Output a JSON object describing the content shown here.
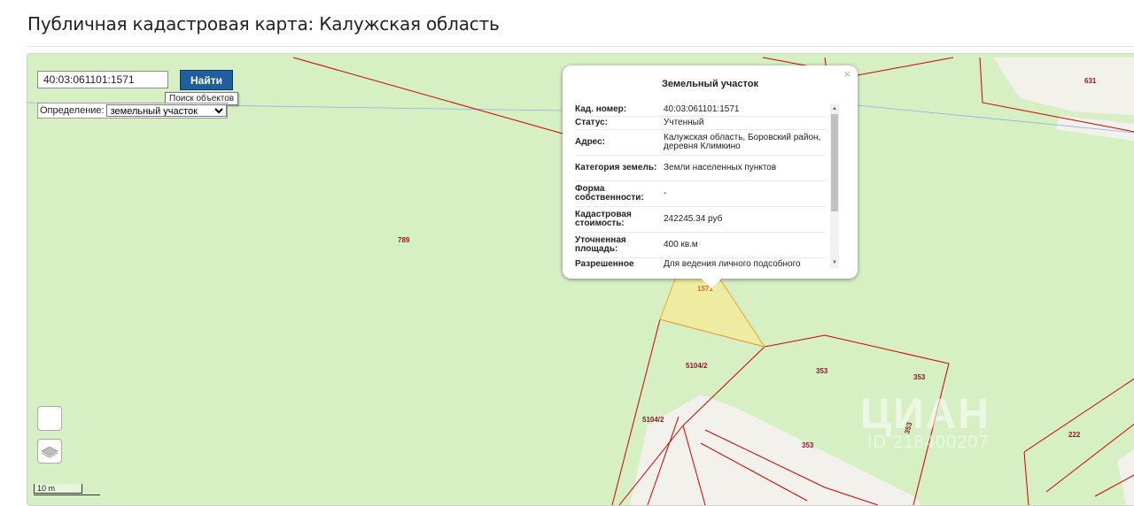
{
  "page": {
    "title": "Публичная кадастровая карта: Калужская область"
  },
  "search": {
    "value": "40:03:061101:1571",
    "button_label": "Найти",
    "tooltip": "Поиск объектов"
  },
  "definition": {
    "label": "Определение:",
    "selected": "земельный участок"
  },
  "scale": {
    "label": "10 m"
  },
  "map_labels": {
    "l789": "789",
    "l631": "631",
    "l1571": "1571",
    "l5104_2a": "5104/2",
    "l5104_2b": "5104/2",
    "l353a": "353",
    "l353b": "353",
    "l353c": "353",
    "l353d": "353",
    "l222": "222"
  },
  "popup": {
    "title": "Земельный участок",
    "close": "×",
    "rows": [
      {
        "label": "Кад. номер:",
        "value": "40:03:061101:1571"
      },
      {
        "label": "Статус:",
        "value": "Учтенный"
      },
      {
        "label": "Адрес:",
        "value": "Калужская область, Боровский район, деревня Климкино"
      },
      {
        "label": "Категория земель:",
        "value": "Земли населенных пунктов"
      },
      {
        "label": "Форма собственности:",
        "value": "-"
      },
      {
        "label": "Кадастровая стоимость:",
        "value": "242245.34 руб"
      },
      {
        "label": "Уточненная площадь:",
        "value": "400 кв.м"
      },
      {
        "label": "Разрешенное",
        "value": "Для ведения личного подсобного"
      }
    ]
  },
  "watermark": {
    "brand": "ЦИАН",
    "id": "ID 218400207"
  },
  "colors": {
    "map_bg": "#d6f0c4",
    "boundary": "#cc0000",
    "selected_fill": "#eeeca0",
    "selected_stroke": "#f0a030",
    "road": "#f3f1ec",
    "button": "#1f5f9e"
  }
}
